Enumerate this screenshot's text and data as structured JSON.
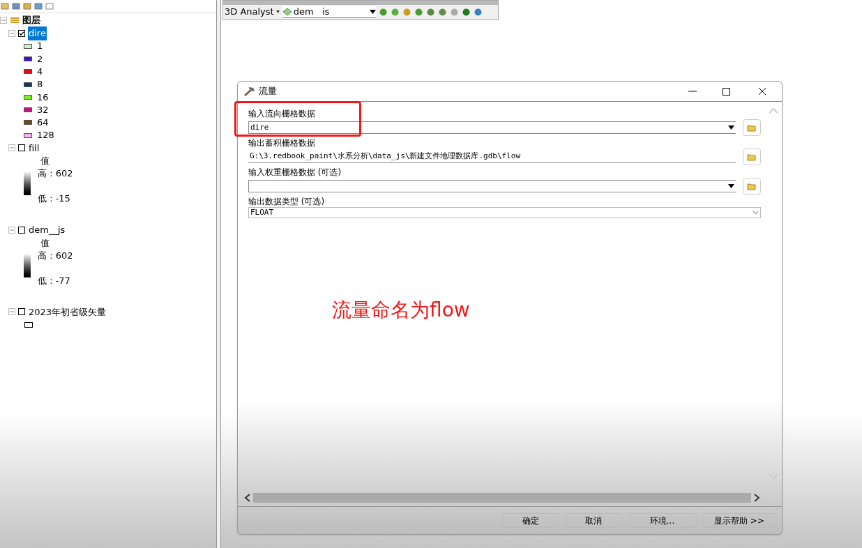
{
  "toc": {
    "root": "图层",
    "layers": [
      {
        "name": "dire",
        "kind": "unique",
        "checked": true,
        "selected": true,
        "expanded": true,
        "classes": [
          {
            "label": "1",
            "color": "#c8f5c8"
          },
          {
            "label": "2",
            "color": "#3a10d0"
          },
          {
            "label": "4",
            "color": "#e00a1e"
          },
          {
            "label": "8",
            "color": "#0c3c5a"
          },
          {
            "label": "16",
            "color": "#78f01e"
          },
          {
            "label": "32",
            "color": "#c0147a"
          },
          {
            "label": "64",
            "color": "#6e4a0a"
          },
          {
            "label": "128",
            "color": "#f5b4f0"
          }
        ]
      },
      {
        "name": "fill",
        "kind": "stretch",
        "checked": false,
        "selected": false,
        "expanded": true,
        "legend_title": "值",
        "high": "高 : 602",
        "low": "低 : -15"
      },
      {
        "name": "dem__js",
        "kind": "stretch",
        "checked": false,
        "selected": false,
        "expanded": true,
        "legend_title": "值",
        "high": "高 : 602",
        "low": "低 : -77"
      },
      {
        "name": "2023年初省级矢量",
        "kind": "polygon",
        "checked": false,
        "selected": false,
        "expanded": true
      }
    ]
  },
  "toolbar": {
    "menu": "3D Analyst",
    "layer": "dem   is"
  },
  "dialog": {
    "title": "流量",
    "fields": [
      {
        "label": "输入流向栅格数据",
        "kind": "combo",
        "value": "dire",
        "highlighted": true
      },
      {
        "label": "输出蓄积栅格数据",
        "kind": "path",
        "value": "G:\\3.redbook_paint\\水系分析\\data_js\\新建文件地理数据库.gdb\\flow",
        "highlighted": false
      },
      {
        "label": "输入权重栅格数据 (可选)",
        "kind": "combo",
        "highlighted": false
      },
      {
        "label": "输出数据类型 (可选)",
        "kind": "select",
        "value": "FLOAT",
        "highlighted": false
      }
    ],
    "annotation": "流量命名为flow",
    "buttons": [
      "确定",
      "取消",
      "环境...",
      "显示帮助 >>"
    ]
  }
}
